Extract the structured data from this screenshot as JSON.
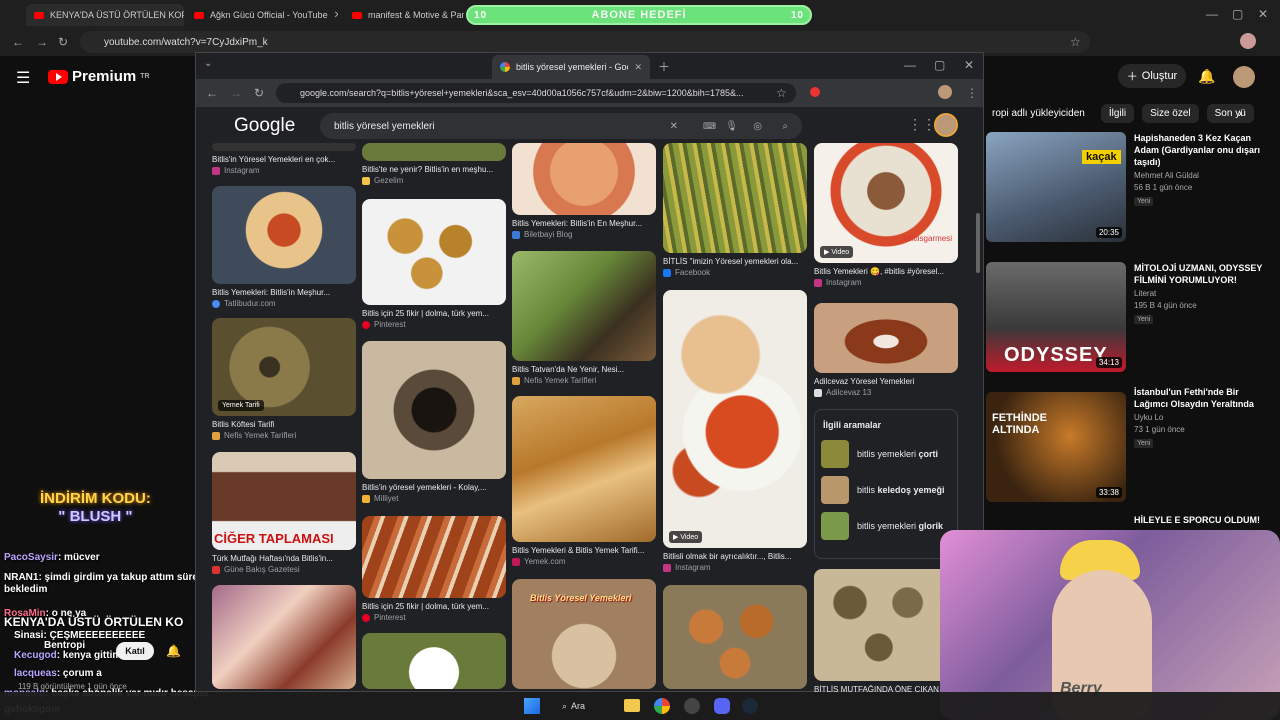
{
  "back_tabs": [
    {
      "label": "KENYA'DA ÜSTÜ ÖRTÜLEN KOP"
    },
    {
      "label": "Ağkn Gücü Official - YouTube"
    },
    {
      "label": "manifest & Motive & Pango"
    }
  ],
  "goal": {
    "label": "ABONE HEDEFİ",
    "left": "10",
    "right": "10"
  },
  "back_url": "youtube.com/watch?v=7CyJdxiPm_k",
  "youtube": {
    "brand": "Premium",
    "region": "TR",
    "create": "Oluştur",
    "chips": [
      "ropi adlı yükleyiciden",
      "İlgili",
      "Size özel",
      "Son yü"
    ],
    "videos": [
      {
        "title": "Hapishaneden 3 Kez Kaçan Adam (Gardiyanlar onu dışarı taşıdı)",
        "channel": "Mehmet Ali Güldal",
        "meta": "56 B  1 gün önce",
        "badge": "Yeni",
        "duration": "20:35",
        "overlay": "kaçak"
      },
      {
        "title": "MİTOLOJİ UZMANI, ODYSSEY FİLMİNİ YORUMLUYOR!",
        "channel": "Literat",
        "meta": "195 B  4 gün önce",
        "badge": "Yeni",
        "duration": "34:13",
        "overlay": "ODYSSEY"
      },
      {
        "title": "İstanbul'un Fethi'nde Bir Lağımcı Olsaydın Yeraltında",
        "channel": "Uyku Lo",
        "meta": "73  1 gün önce",
        "badge": "Yeni",
        "duration": "33:38",
        "overlay": "FETHİNDE ALTINDA"
      },
      {
        "title": "HİLEYLE E SPORCU OLDUM!",
        "channel": "",
        "meta": "",
        "badge": "",
        "duration": "",
        "overlay": ""
      }
    ]
  },
  "front": {
    "tab": "bitlis yöresel yemekleri - Googl",
    "url": "google.com/search?q=bitlis+yöresel+yemekleri&sca_esv=40d00a1056c757cf&udm=2&biw=1200&bih=1785&...",
    "logo": "Google",
    "query": "bitlis yöresel yemekleri"
  },
  "results": [
    {
      "caption": "Bitlis'in Yöresel Yemekleri en çok...",
      "source": "Instagram",
      "badge": ""
    },
    {
      "caption": "Bitlis Yemekleri: Bitlis'in Meşhur...",
      "source": "Tatlibudur.com",
      "badge": ""
    },
    {
      "caption": "Bitlis Köftesi Tarifi",
      "source": "Nefis Yemek Tarifleri",
      "badge": "Yemek Tarifi"
    },
    {
      "caption": "Türk Mutfağı Haftası'nda Bitlis'in...",
      "source": "Güne Bakış Gazetesi",
      "badge": "CİĞER TAPLAMASI"
    },
    {
      "caption": "Bitlis'te ne yenir? Bitlis'in en meşhu...",
      "source": "Gezelim",
      "badge": ""
    },
    {
      "caption": "Bitlis için 25 fikir | dolma, türk yem...",
      "source": "Pinterest",
      "badge": ""
    },
    {
      "caption": "Bitlis'in yöresel yemekleri - Kolay,...",
      "source": "Milliyet",
      "badge": ""
    },
    {
      "caption": "Bitlis için 25 fikir | dolma, türk yem...",
      "source": "Pinterest",
      "badge": ""
    },
    {
      "caption": "Bitlis Yemekleri: Bitlis'in En Meşhur...",
      "source": "Biletbayi Blog",
      "badge": ""
    },
    {
      "caption": "Bitlis Tatvan'da Ne Yenir, Nesi...",
      "source": "Nefis Yemek Tarifleri",
      "badge": ""
    },
    {
      "caption": "Bitlis Yemekleri & Bitlis Yemek Tarifi...",
      "source": "Yemek.com",
      "badge": ""
    },
    {
      "caption": "BİTLİS \"imizin Yöresel yemekleri ola...",
      "source": "Facebook",
      "badge": ""
    },
    {
      "caption": "Bitlisli olmak bir ayrıcalıktır..., Bitlis...",
      "source": "Instagram",
      "badge": "Video"
    },
    {
      "caption": "Bitlis Yemekleri 😋, #bitlis #yöresel...",
      "source": "Instagram",
      "badge": "Video"
    },
    {
      "caption": "Adilcevaz Yöresel Yemekleri",
      "source": "Adilcevaz 13",
      "badge": ""
    },
    {
      "caption": "BİTLİS MUTFAĞINDA ÖNE ÇIKAN",
      "source": "",
      "badge": ""
    }
  ],
  "related": {
    "title": "İlgili aramalar",
    "items": [
      {
        "prefix": "bitlis yemekleri ",
        "bold": "çorti"
      },
      {
        "prefix": "bitlis ",
        "bold": "keledoş yemeği"
      },
      {
        "prefix": "bitlis yemekleri ",
        "bold": "glorik"
      }
    ]
  },
  "overlay_text": {
    "bitlis_watermark": "#bitlisgarmesi",
    "yoresel_banner": "Bitlis Yöresel Yemekleri"
  },
  "promo": {
    "line1": "İNDİRİM KODU:",
    "line2": "\" BLUSH \""
  },
  "chat": [
    {
      "user": "PacoSaysir",
      "msg": ": mücver"
    },
    {
      "user": "NRAN1",
      "msg": ": şimdi girdim ya takup attım süreyi bekledim"
    },
    {
      "user": "RosaMin",
      "msg": ": o ne ya"
    },
    {
      "user": "Sinasi",
      "msg": ": ÇEŞMEEEEEEEEEE"
    },
    {
      "user": "Bentropi",
      "msg": ""
    },
    {
      "user": "Kecugod",
      "msg": ": kenya gittim"
    },
    {
      "user": "lacqueas",
      "msg": ": çorum a"
    },
    {
      "user": "monsalp",
      "msg": ": başka abonelik var mıdır hesapta"
    },
    {
      "user": "gsfioksgom",
      "msg": ""
    }
  ],
  "chat_overlay": {
    "title": "KENYA'DA ÜSTÜ ÖRTÜLEN KO",
    "join": "Katıl",
    "views": "119 B görüntüleme  1 gün önce"
  },
  "taskbar": {
    "search": "Ara"
  },
  "cam": {
    "shirt": "Berry"
  }
}
